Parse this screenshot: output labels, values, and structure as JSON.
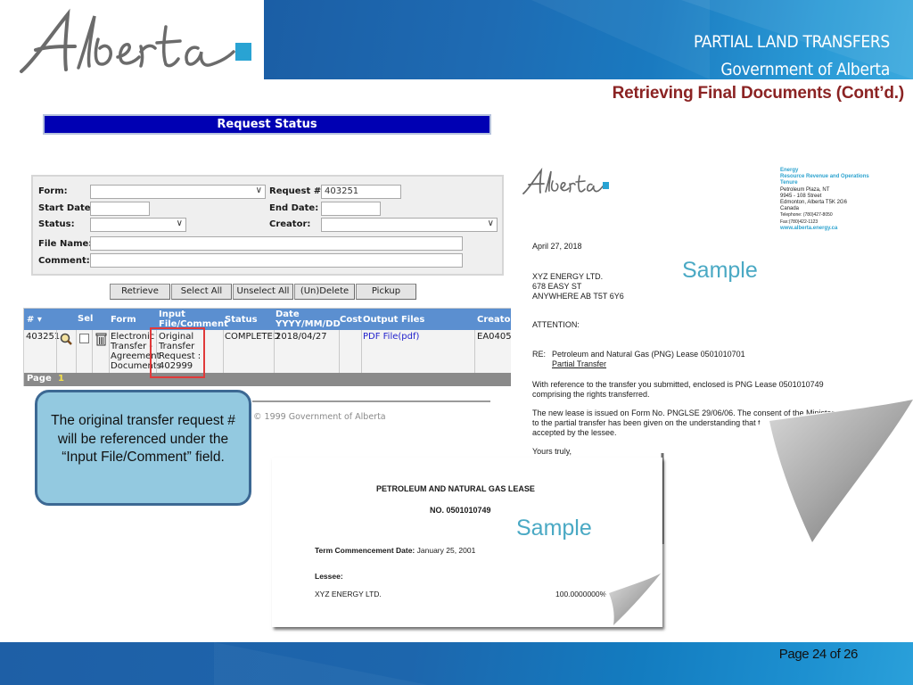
{
  "header": {
    "logo_text": "Alberta",
    "title_line1": "PARTIAL LAND TRANSFERS",
    "title_line2": "Government of Alberta",
    "section_title": "Retrieving Final Documents (Cont’d.)"
  },
  "colors": {
    "header_blue": "#1b5ea5",
    "section_title": "#8b2323",
    "request_status_bar": "#0000b3",
    "table_header": "#5b8fd0",
    "callout_fill": "#93c9e0",
    "callout_border": "#3c6893",
    "highlight_red": "#e03a3a",
    "sample_teal": "#4aa9c4",
    "logo_square": "#29a3d3"
  },
  "request_status": {
    "title": "Request Status",
    "form": {
      "form_label": "Form:",
      "form_value": "",
      "request_label": "Request #:",
      "request_value": "403251",
      "start_date_label": "Start Date:",
      "start_date_value": "",
      "end_date_label": "End Date:",
      "end_date_value": "",
      "status_label": "Status:",
      "status_value": "",
      "creator_label": "Creator:",
      "creator_value": "",
      "file_name_label": "File Name:",
      "file_name_value": "",
      "comment_label": "Comment:",
      "comment_value": ""
    },
    "buttons": [
      "Retrieve",
      "Select All",
      "Unselect All",
      "(Un)Delete",
      "Pickup"
    ],
    "table": {
      "headers": {
        "num": "# ▾",
        "sel": "Sel",
        "form": "Form",
        "input_line1": "Input",
        "input_line2": "File/Comment",
        "status": "Status",
        "date_line1": "Date",
        "date_line2": "YYYY/MM/DD",
        "cost": "Cost",
        "output": "Output Files",
        "creator": "Creator"
      },
      "rows": [
        {
          "num": "403251",
          "form_lines": [
            "Electronic",
            "Transfer -",
            "Agreement",
            "Documents"
          ],
          "input_lines": [
            "Original",
            "Transfer",
            "Request :",
            "402999"
          ],
          "status": "COMPLETED",
          "date": "2018/04/27",
          "cost": "",
          "output": "PDF File(pdf)",
          "creator": "EA0405"
        }
      ],
      "pager_label": "Page",
      "pager_current": "1"
    },
    "copyright": "© 1999 Government of Alberta"
  },
  "callout": {
    "text": "The original transfer request # will be referenced under the “Input File/Comment” field."
  },
  "letter": {
    "logo_text": "Alberta",
    "address_lines_blue": [
      "Energy",
      "Resource Revenue and Operations",
      "Tenure"
    ],
    "address_lines": [
      "Petroleum Plaza, NT",
      "9945 - 108 Street",
      "Edmonton, Alberta  T5K 2G6",
      "Canada",
      "Telephone: (780)427-8050",
      "Fax:(780)422-1123"
    ],
    "website": "www.alberta.energy.ca",
    "date": "April 27, 2018",
    "recipient_lines": [
      "XYZ ENERGY LTD.",
      "678 EASY ST",
      "ANYWHERE AB  T5T 6Y6"
    ],
    "attention": "ATTENTION:",
    "re_prefix": "RE:",
    "re_line": "Petroleum and Natural Gas (PNG) Lease 0501010701",
    "re_subject": "Partial Transfer",
    "para1_line1": "With reference to the transfer you submitted, enclosed is PNG Lease 0501010749",
    "para1_line2": "comprising the rights transferred.",
    "para2_line1": "The new lease is issued on Form No. PNGLSE 29/06/06.  The consent of the Minister",
    "para2_line2": "to the partial transfer has been given on the understanding that th",
    "para2_line3": "accepted by the lessee.",
    "closing": "Yours truly,",
    "watermark": "Sample"
  },
  "lease": {
    "title": "PETROLEUM AND NATURAL GAS LEASE",
    "number": "NO. 0501010749",
    "watermark": "Sample",
    "term_label": "Term Commencement Date:",
    "term_value": "January 25, 2001",
    "lessee_label": "Lessee:",
    "lessee_name": "XYZ ENERGY LTD.",
    "lessee_share": "100.0000000%"
  },
  "footer": {
    "page_label": "Page 24 of 26"
  }
}
